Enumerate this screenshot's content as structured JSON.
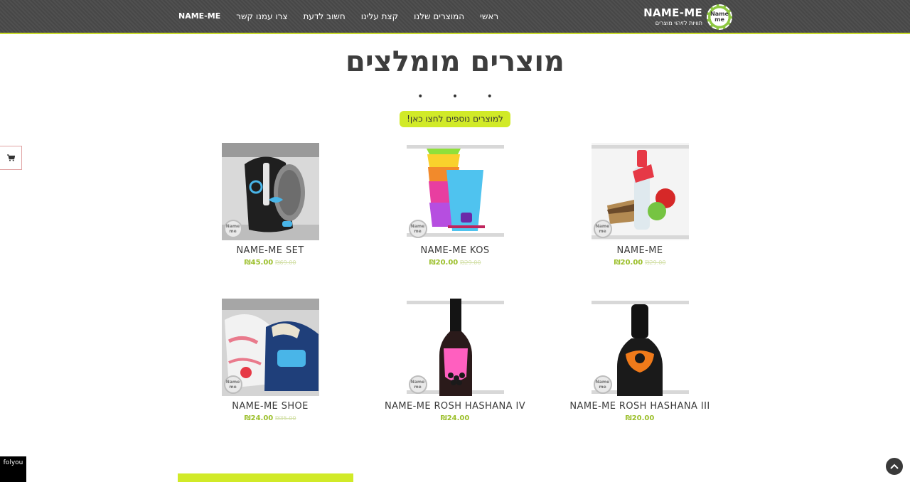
{
  "header": {
    "nav": [
      "NAME-ME",
      "צרו עמנו קשר",
      "חשוב לדעת",
      "קצת עלינו",
      "המוצרים שלנו",
      "ראשי"
    ],
    "logo_name": "NAME-ME",
    "logo_sub": "תוויות לזיהוי מוצרים",
    "logo_badge_line1": "Name",
    "logo_badge_line2": "me"
  },
  "main": {
    "title": "מוצרים מומלצים",
    "dots": "• • •",
    "more_button": "למוצרים נוספים לחצו כאן!"
  },
  "products": [
    {
      "name": "NAME-ME SET",
      "price": "₪45.00",
      "old_price": "₪69.00"
    },
    {
      "name": "NAME-ME KOS",
      "price": "₪20.00",
      "old_price": "₪29.00"
    },
    {
      "name": "NAME-ME",
      "price": "₪20.00",
      "old_price": "₪29.00"
    },
    {
      "name": "NAME-ME SHOE",
      "price": "₪24.00",
      "old_price": "₪35.00"
    },
    {
      "name": "NAME-ME ROSH HASHANA IV",
      "price": "₪24.00"
    },
    {
      "name": "NAME-ME ROSH HASHANA III",
      "price": "₪20.00"
    }
  ],
  "product_stamp": "Name me",
  "footer": {
    "folyou": "folyou"
  },
  "colors": {
    "accent": "#d1ea28",
    "header_bg": "#4a4a4a",
    "price": "#9bbf2a"
  }
}
